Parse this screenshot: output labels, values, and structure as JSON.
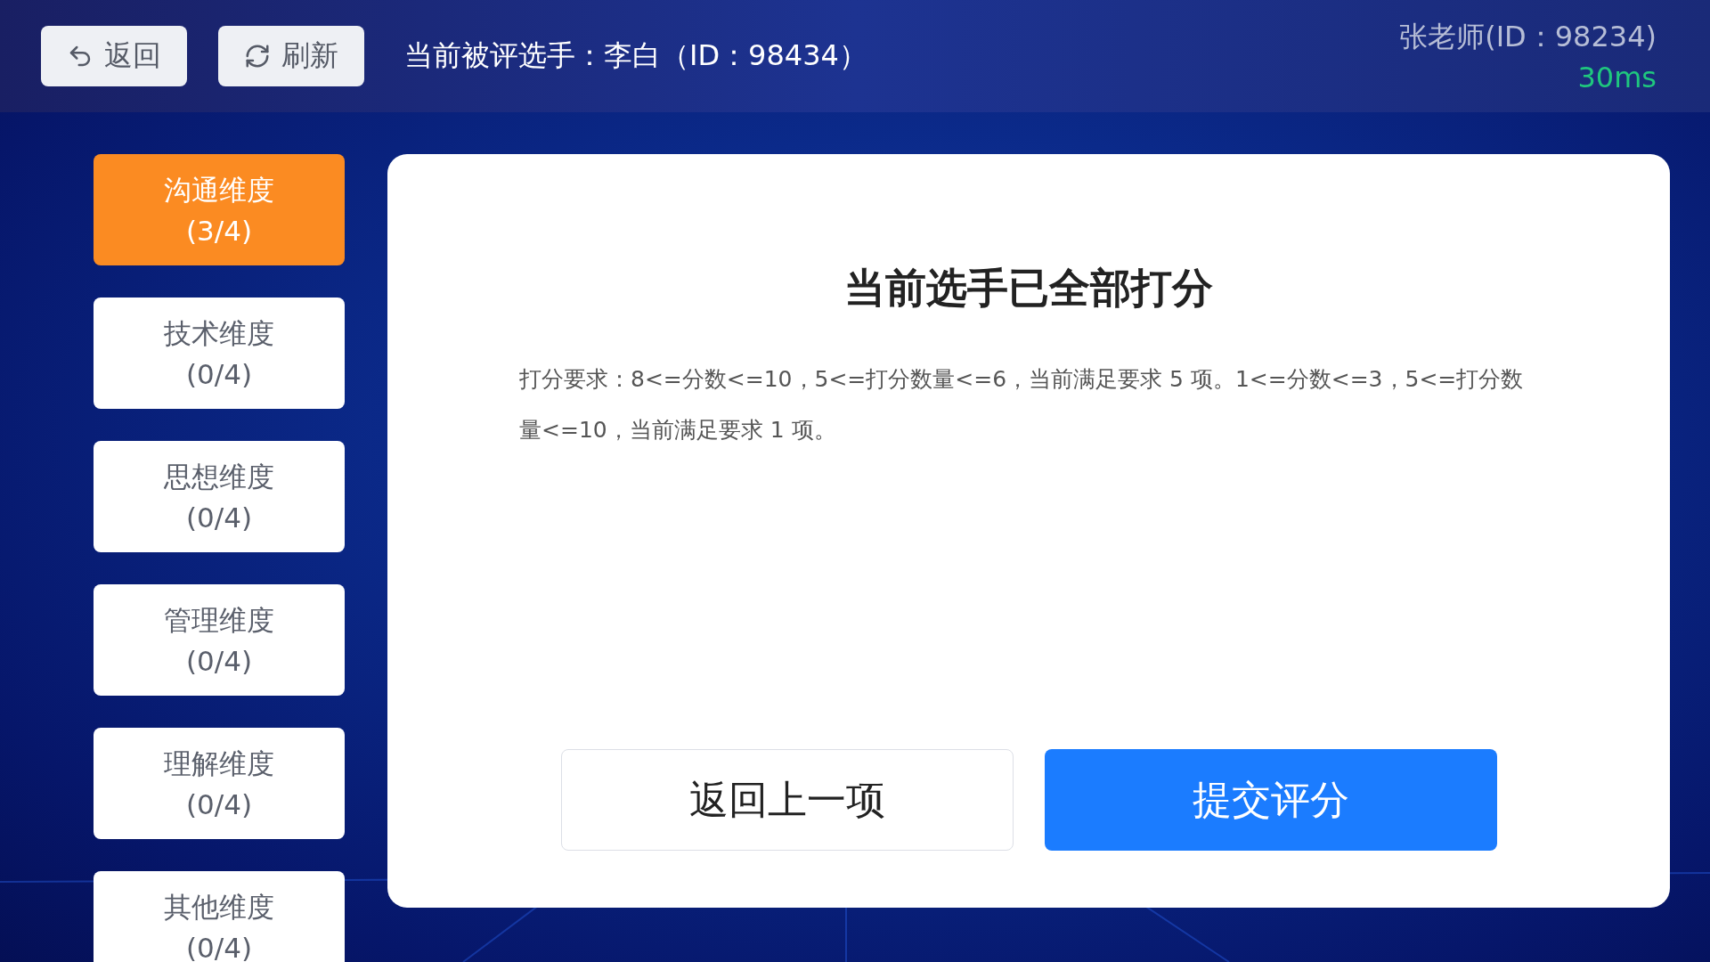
{
  "header": {
    "buttons": [
      {
        "kind": "back",
        "label": "返回"
      },
      {
        "kind": "refresh",
        "label": "刷新"
      }
    ],
    "current_player": "当前被评选手：李白（ID：98434）",
    "judge": "张老师(ID：98234)",
    "latency": "30ms"
  },
  "sidebar": {
    "items": [
      {
        "label": "沟通维度",
        "progress": "(3/4)",
        "selected": true
      },
      {
        "label": "技术维度",
        "progress": "(0/4)",
        "selected": false
      },
      {
        "label": "思想维度",
        "progress": "(0/4)",
        "selected": false
      },
      {
        "label": "管理维度",
        "progress": "(0/4)",
        "selected": false
      },
      {
        "label": "理解维度",
        "progress": "(0/4)",
        "selected": false
      },
      {
        "label": "其他维度",
        "progress": "(0/4)",
        "selected": false
      }
    ]
  },
  "panel": {
    "title": "当前选手已全部打分",
    "requirement": "打分要求：8<=分数<=10，5<=打分数量<=6，当前满足要求 5 项。1<=分数<=3，5<=打分数量<=10，当前满足要求 1 项。",
    "actions": [
      {
        "kind": "secondary",
        "label": "返回上一项"
      },
      {
        "kind": "primary",
        "label": "提交评分"
      }
    ]
  }
}
